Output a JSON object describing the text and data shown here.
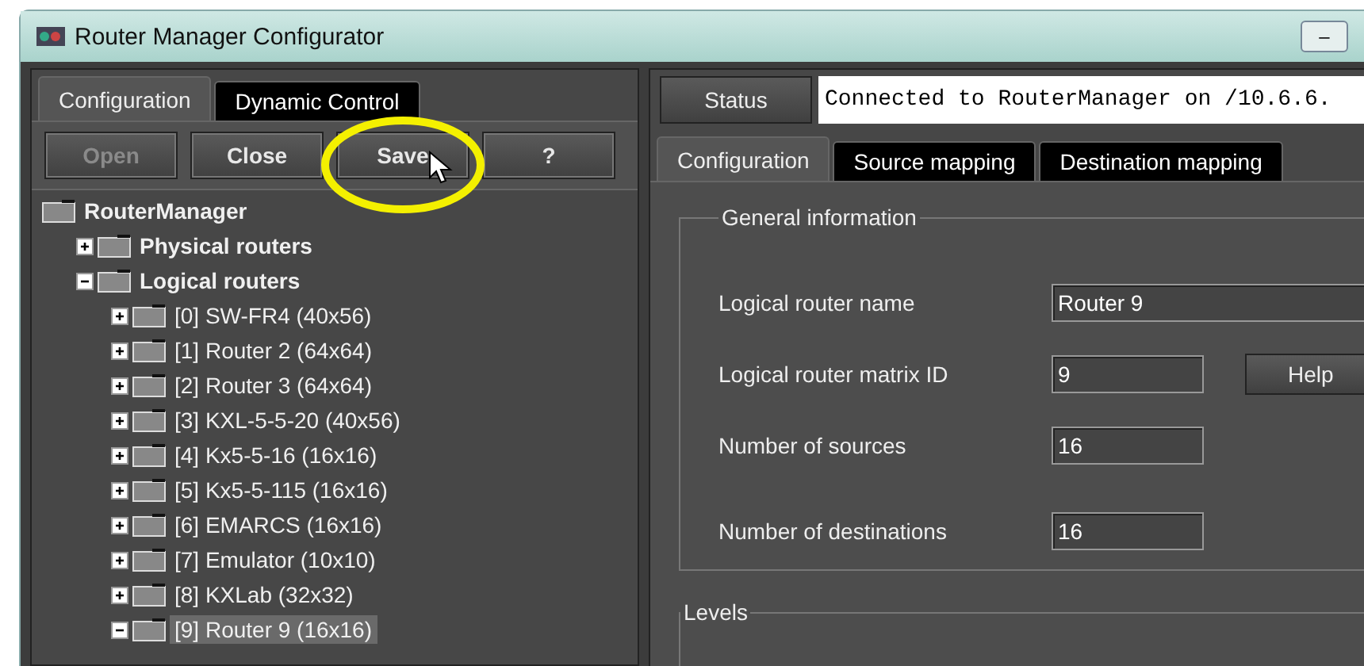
{
  "window": {
    "title": "Router Manager Configurator",
    "minimize": "–"
  },
  "left_tabs": [
    {
      "label": "Configuration",
      "selected": true
    },
    {
      "label": "Dynamic Control",
      "selected": false
    }
  ],
  "toolbar": [
    {
      "label": "Open",
      "disabled": true
    },
    {
      "label": "Close",
      "disabled": false
    },
    {
      "label": "Save",
      "disabled": false,
      "highlighted": true
    },
    {
      "label": "?",
      "disabled": false
    }
  ],
  "tree": [
    {
      "label": "RouterManager",
      "selected": false,
      "children": [
        {
          "label": "Physical routers",
          "expanded": false,
          "selected": false
        },
        {
          "label": "Logical routers",
          "expanded": true,
          "selected": false,
          "children": [
            {
              "label": "[0] SW-FR4 (40x56)",
              "expanded": false,
              "selected": false
            },
            {
              "label": "[1] Router 2 (64x64)",
              "expanded": false,
              "selected": false
            },
            {
              "label": "[2] Router 3 (64x64)",
              "expanded": false,
              "selected": false
            },
            {
              "label": "[3] KXL-5-5-20 (40x56)",
              "expanded": false,
              "selected": false
            },
            {
              "label": "[4] Kx5-5-16 (16x16)",
              "expanded": false,
              "selected": false
            },
            {
              "label": "[5] Kx5-5-115 (16x16)",
              "expanded": false,
              "selected": false
            },
            {
              "label": "[6] EMARCS (16x16)",
              "expanded": false,
              "selected": false
            },
            {
              "label": "[7] Emulator (10x10)",
              "expanded": false,
              "selected": false
            },
            {
              "label": "[8] KXLab (32x32)",
              "expanded": false,
              "selected": false
            },
            {
              "label": "[9] Router 9 (16x16)",
              "expanded": true,
              "selected": true
            }
          ]
        }
      ]
    }
  ],
  "status": {
    "button": "Status",
    "text": "Connected to RouterManager on /10.6.6."
  },
  "right_tabs": [
    {
      "label": "Configuration",
      "selected": true
    },
    {
      "label": "Source mapping",
      "selected": false
    },
    {
      "label": "Destination mapping",
      "selected": false
    }
  ],
  "general_information": {
    "legend": "General information",
    "fields": [
      {
        "label": "Logical router name",
        "value": "Router 9",
        "kind": "wide"
      },
      {
        "label": "Logical router matrix ID",
        "value": "9",
        "kind": "help",
        "button": "Help"
      },
      {
        "label": "Number of sources",
        "value": "16",
        "kind": "short"
      },
      {
        "label": "Number of destinations",
        "value": "16",
        "kind": "short"
      }
    ]
  },
  "levels": {
    "legend": "Levels"
  }
}
